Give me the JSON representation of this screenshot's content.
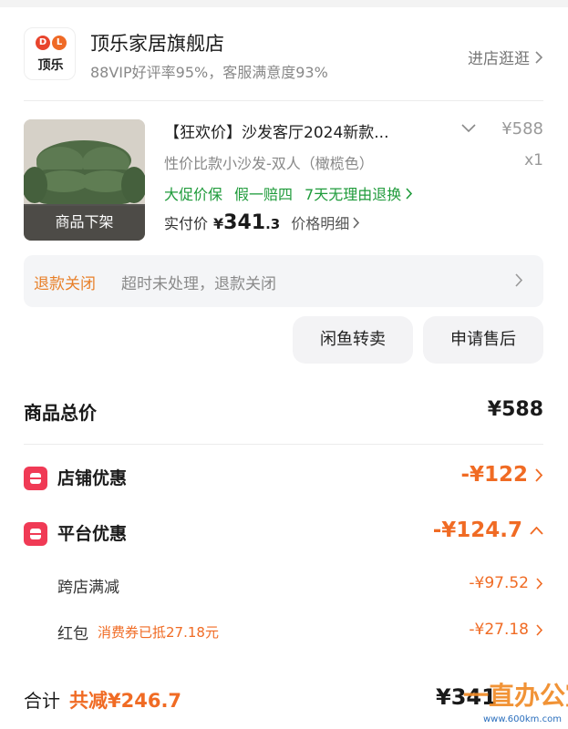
{
  "store": {
    "logo_letters": [
      "D",
      "L"
    ],
    "logo_text": "顶乐",
    "name": "顶乐家居旗舰店",
    "subtitle": "88VIP好评率95%，客服满意度93%",
    "enter_label": "进店逛逛"
  },
  "product": {
    "overlay": "商品下架",
    "title": "【狂欢价】沙发客厅2024新款...",
    "price": "¥588",
    "spec": "性价比款小沙发-双人（橄榄色）",
    "qty": "x1",
    "tags": [
      "大促价保",
      "假一赔四",
      "7天无理由退换"
    ],
    "actual_label": "实付价",
    "actual_yen": "¥",
    "actual_int": "341",
    "actual_dec": ".3",
    "detail_label": "价格明细"
  },
  "refund": {
    "state": "退款关闭",
    "desc": "超时未处理，退款关闭"
  },
  "actions": {
    "resell": "闲鱼转卖",
    "after_sale": "申请售后"
  },
  "summary": {
    "total_label": "商品总价",
    "total_value": "¥588",
    "store_discount_label": "店铺优惠",
    "store_discount_value": "-¥122",
    "platform_discount_label": "平台优惠",
    "platform_discount_value": "-¥124.7",
    "cross_store_label": "跨店满减",
    "cross_store_value": "-¥97.52",
    "red_packet_label": "红包",
    "red_packet_note": "消费券已抵27.18元",
    "red_packet_value": "-¥27.18",
    "sum_label": "合计",
    "saved_label": "共减¥246.7",
    "sum_value": "¥341"
  },
  "watermark": {
    "main": "一直办公室",
    "sub": "www.600km.com"
  },
  "colors": {
    "accent_orange": "#f06b24",
    "green": "#1f9b3b",
    "coupon_red": "#f03a55"
  }
}
